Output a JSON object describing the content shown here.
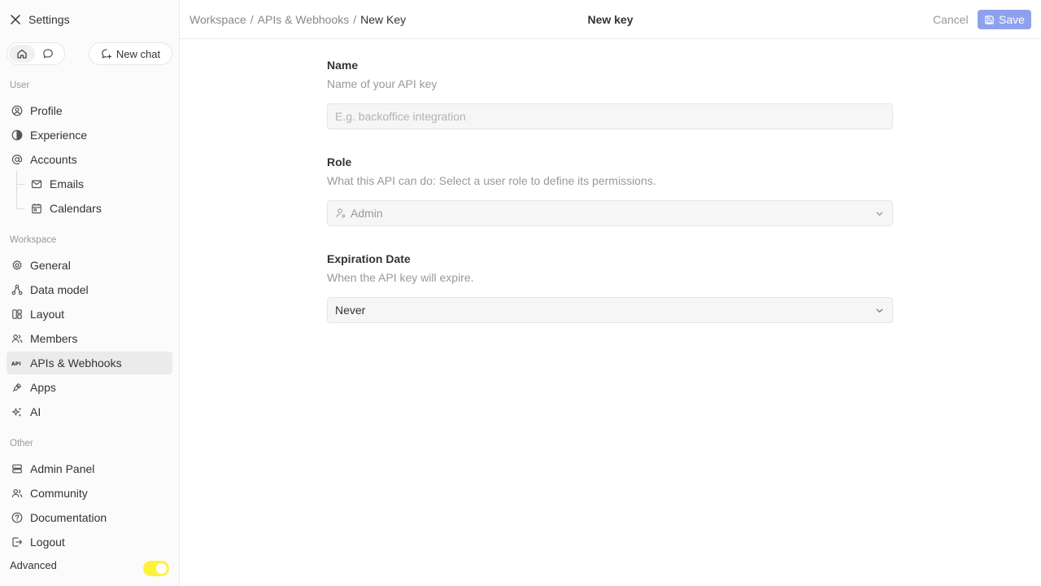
{
  "sidebar": {
    "title": "Settings",
    "new_chat_label": "New chat",
    "sections": {
      "user": "User",
      "workspace": "Workspace",
      "other": "Other"
    },
    "items": {
      "profile": "Profile",
      "experience": "Experience",
      "accounts": "Accounts",
      "emails": "Emails",
      "calendars": "Calendars",
      "general": "General",
      "data_model": "Data model",
      "layout": "Layout",
      "members": "Members",
      "apis_webhooks": "APIs & Webhooks",
      "apps": "Apps",
      "ai": "AI",
      "admin_panel": "Admin Panel",
      "community": "Community",
      "documentation": "Documentation",
      "logout": "Logout"
    },
    "active_item": "APIs & Webhooks",
    "advanced_label": "Advanced",
    "advanced_enabled": true,
    "accent_color": "#fff23b"
  },
  "header": {
    "breadcrumb": [
      "Workspace",
      "APIs & Webhooks",
      "New Key"
    ],
    "separator": "/",
    "title": "New key",
    "cancel_label": "Cancel",
    "save_label": "Save",
    "save_color": "#8fa1ee"
  },
  "form": {
    "name": {
      "label": "Name",
      "description": "Name of your API key",
      "value": "",
      "placeholder": "E.g. backoffice integration"
    },
    "role": {
      "label": "Role",
      "description": "What this API can do: Select a user role to define its permissions.",
      "value": "Admin"
    },
    "expiration": {
      "label": "Expiration Date",
      "description": "When the API key will expire.",
      "value": "Never"
    }
  }
}
